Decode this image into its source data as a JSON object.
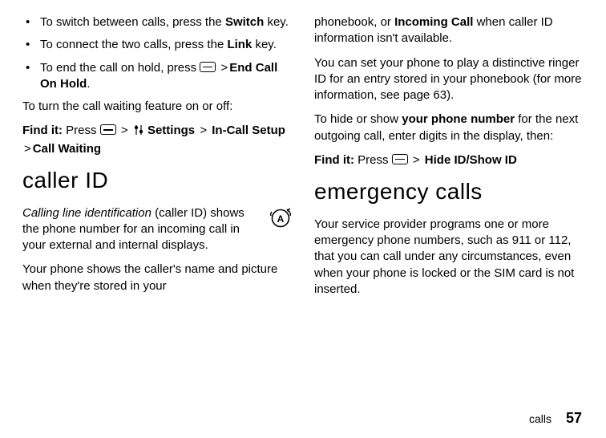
{
  "left": {
    "bullets": [
      {
        "pre": "To switch between calls, press the ",
        "boldKey": "Switch",
        "post": " key."
      },
      {
        "pre": "To connect the two calls, press the ",
        "boldKey": "Link",
        "post": " key."
      },
      {
        "pre": "To end the call on hold, press ",
        "boldKey": "End Call On Hold",
        "post": ".",
        "hasMenuIcon": true
      }
    ],
    "cwIntro": "To turn the call waiting feature on or off:",
    "findItLabel": "Find it:",
    "pressWord": "Press",
    "settingsLabel": "Settings",
    "inCallSetup": "In-Call Setup",
    "callWaiting": "Call Waiting",
    "callerIdHeading": "caller ID",
    "callerIdItalic": "Calling line identification",
    "callerIdRest": " (caller ID) shows the phone number for an incoming call in your external and internal displays.",
    "callerIdPara2": "Your phone shows the caller's name and picture when they're stored in your"
  },
  "right": {
    "cont1a": "phonebook, or ",
    "cont1bold": "Incoming Call",
    "cont1b": " when caller ID information isn't available.",
    "para2": "You can set your phone to play a distinctive ringer ID for an entry stored in your phonebook (for more information, see page 63).",
    "para3a": "To hide or show ",
    "para3bold": "your phone number",
    "para3b": " for the next outgoing call, enter digits in the display, then:",
    "findItLabel": "Find it:",
    "pressWord": "Press",
    "hideShow": "Hide ID/Show ID",
    "emergencyHeading": "emergency calls",
    "emergencyPara": "Your service provider programs one or more emergency phone numbers, such as 911 or 112, that you can call under any circumstances, even when your phone is locked or the SIM card is not inserted."
  },
  "footer": {
    "label": "calls",
    "page": "57"
  },
  "gt": ">"
}
